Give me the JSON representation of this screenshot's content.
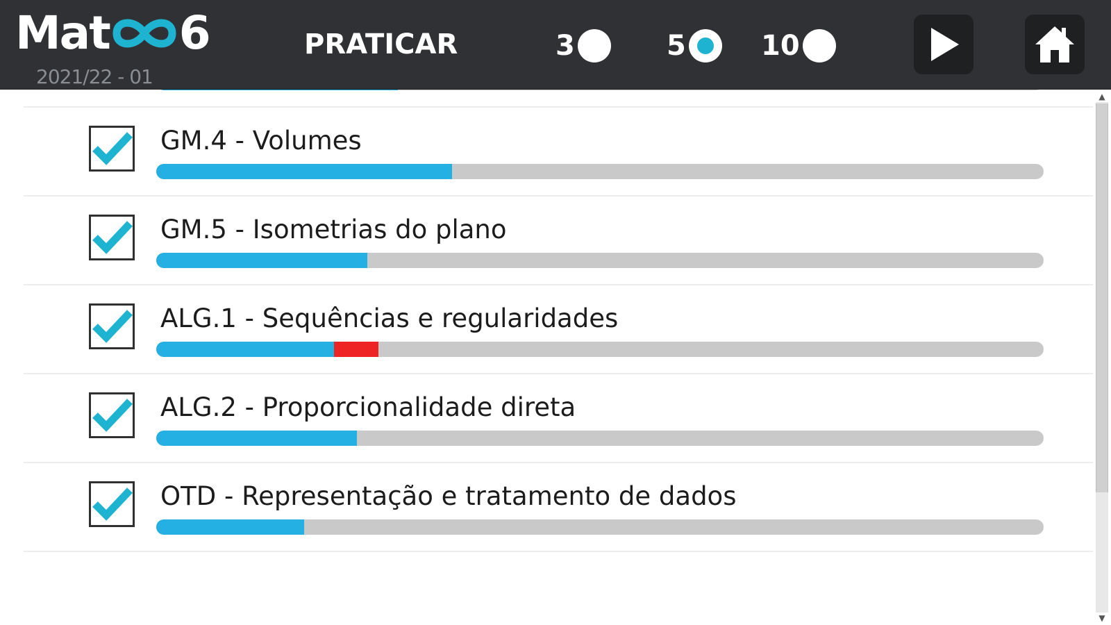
{
  "app": {
    "logo_left": "Mat",
    "logo_right": "6",
    "version": "2021/22 - 01"
  },
  "header": {
    "practice_label": "PRATICAR",
    "question_counts": [
      {
        "value": "3",
        "selected": false
      },
      {
        "value": "5",
        "selected": true
      },
      {
        "value": "10",
        "selected": false
      }
    ],
    "play_icon": "play-icon",
    "home_icon": "home-icon"
  },
  "colors": {
    "header_bg": "#2f3134",
    "accent": "#1eb3d1",
    "progress_fill": "#25b0e4",
    "progress_error": "#ee2424",
    "progress_track": "#c9c9c9",
    "check": "#1eb3d1"
  },
  "topics": [
    {
      "label": "",
      "checked": true,
      "progress": 0.272,
      "error": 0
    },
    {
      "label": "GM.4 - Volumes",
      "checked": true,
      "progress": 0.333,
      "error": 0
    },
    {
      "label": "GM.5 - Isometrias do plano",
      "checked": true,
      "progress": 0.238,
      "error": 0
    },
    {
      "label": "ALG.1 - Sequências e regularidades",
      "checked": true,
      "progress": 0.2,
      "error": 0.05
    },
    {
      "label": "ALG.2 - Proporcionalidade direta",
      "checked": true,
      "progress": 0.226,
      "error": 0
    },
    {
      "label": "OTD - Representação e tratamento de dados",
      "checked": true,
      "progress": 0.167,
      "error": 0
    }
  ]
}
